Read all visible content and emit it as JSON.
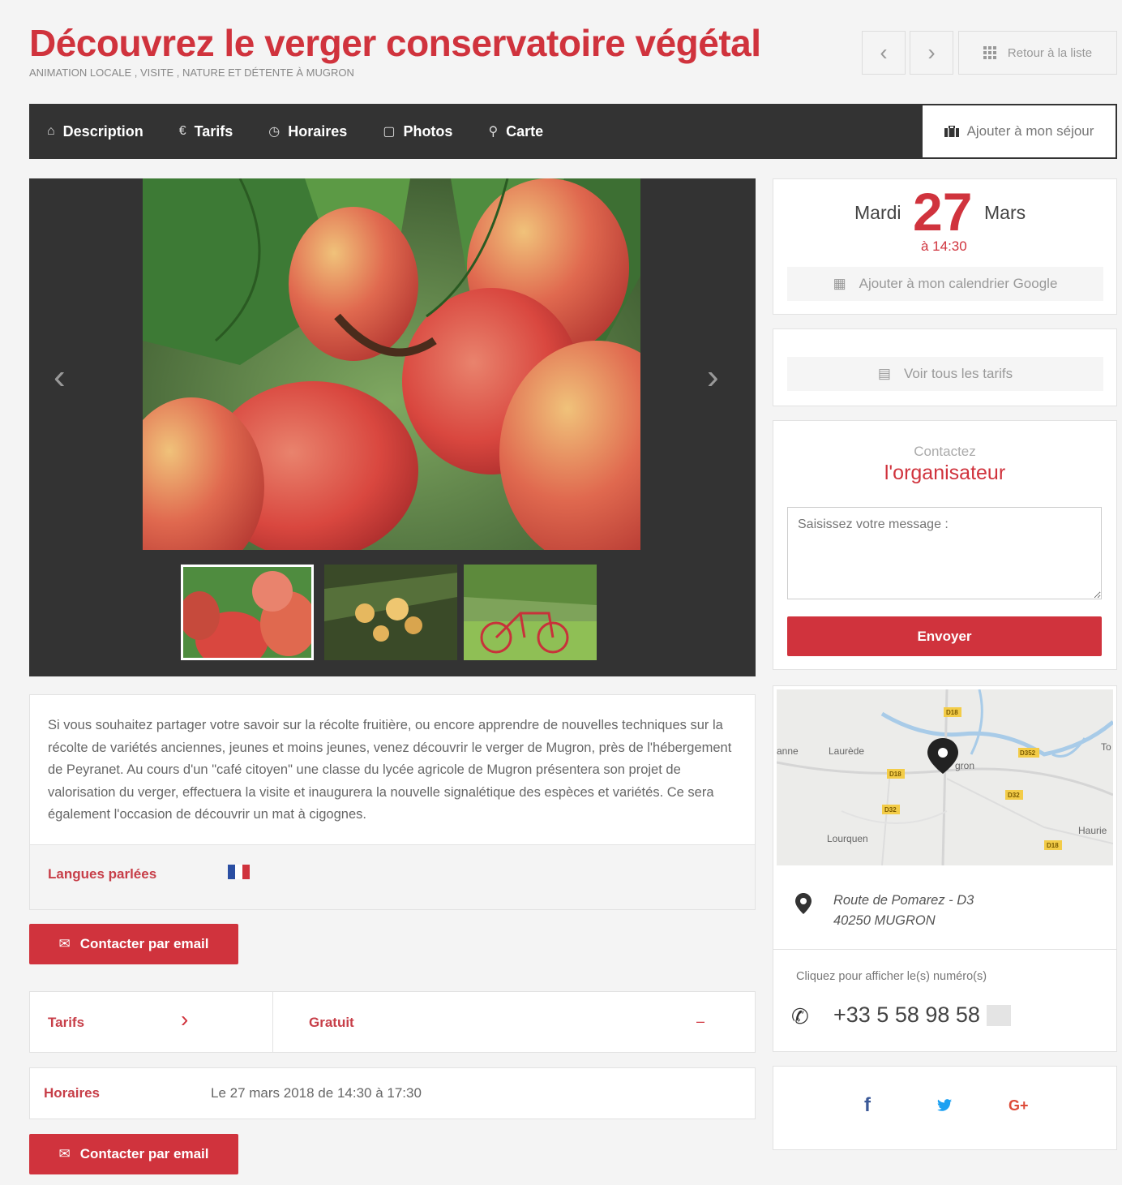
{
  "header": {
    "title": "Découvrez le verger conservatoire végétal",
    "subtitle": "ANIMATION LOCALE , VISITE , NATURE ET DÉTENTE À MUGRON",
    "prev_icon": "‹",
    "next_icon": "›",
    "back_label": "Retour à la liste"
  },
  "tabs": [
    {
      "label": "Description",
      "icon": "⌂"
    },
    {
      "label": "Tarifs",
      "icon": "€"
    },
    {
      "label": "Horaires",
      "icon": "◷"
    },
    {
      "label": "Photos",
      "icon": "▢"
    },
    {
      "label": "Carte",
      "icon": "⚲"
    }
  ],
  "sejour_label": "Ajouter à mon séjour",
  "gallery": {
    "prev": "‹",
    "next": "›",
    "thumb_count": 3
  },
  "description": "Si vous souhaitez partager votre savoir sur la récolte fruitière, ou encore apprendre de nouvelles techniques sur la récolte de variétés anciennes, jeunes et moins jeunes, venez découvrir le verger de Mugron, près de l'hébergement de Peyranet. Au cours d'un \"café citoyen\" une classe du lycée agricole de Mugron présentera son projet de valorisation du verger, effectuera la visite et inaugurera la nouvelle signalétique des espèces et variétés. Ce sera également l'occasion de découvrir un mat à cigognes.",
  "languages": {
    "label": "Langues parlées"
  },
  "contact_email_label": "Contacter par email",
  "tarifs": {
    "label": "Tarifs",
    "chevron": "›",
    "value": "Gratuit",
    "dash": "–"
  },
  "horaires": {
    "label": "Horaires",
    "value": "Le 27 mars 2018 de 14:30 à 17:30"
  },
  "date": {
    "weekday": "Mardi",
    "day": "27",
    "month": "Mars",
    "time": "à 14:30",
    "calendar_label": "Ajouter à mon calendrier Google"
  },
  "tarif_card": {
    "label": "Voir tous les tarifs"
  },
  "contact": {
    "small": "Contactez",
    "big": "l'organisateur",
    "placeholder": "Saisissez votre message :",
    "send_label": "Envoyer"
  },
  "map": {
    "places": [
      "anne",
      "Laurède",
      "gron",
      "Lourquen",
      "Haurie",
      "To"
    ],
    "roads": [
      "D18",
      "D352",
      "D18",
      "D32",
      "D32",
      "D18"
    ]
  },
  "address": {
    "line1": "Route de Pomarez - D3",
    "line2": "40250  MUGRON"
  },
  "phone": {
    "hint": "Cliquez pour afficher le(s) numéro(s)",
    "number": "+33 5 58 98 58"
  },
  "social": {
    "facebook": "f",
    "twitter": "🐦",
    "google": "G+"
  },
  "colors": {
    "accent": "#d0333d",
    "dark": "#333333"
  }
}
